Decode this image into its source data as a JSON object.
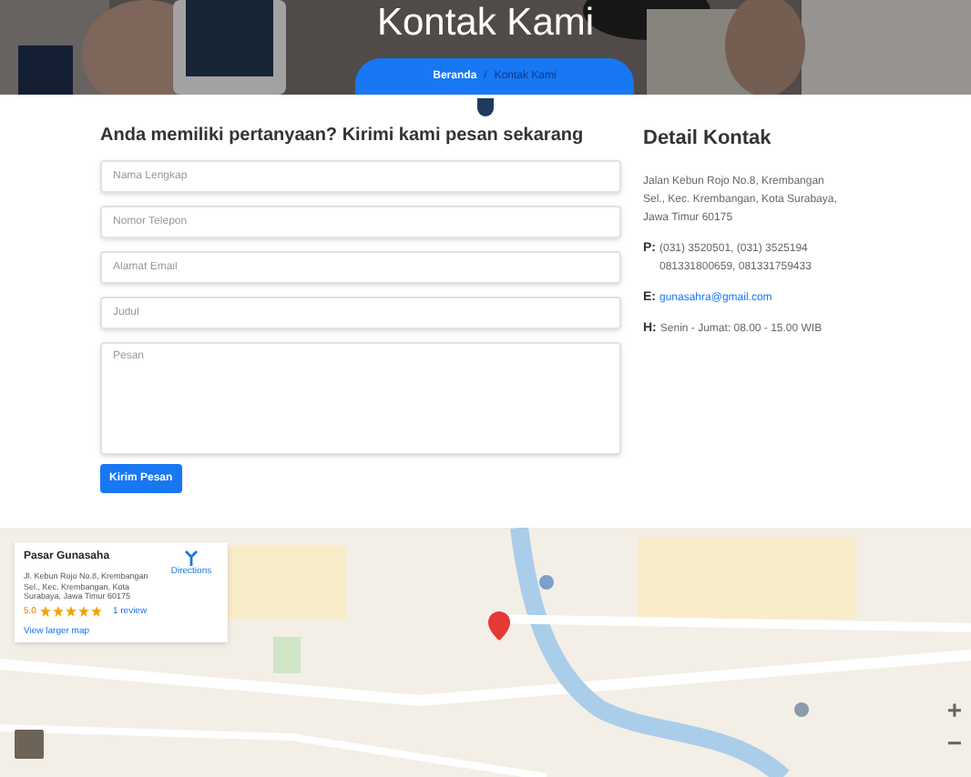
{
  "hero": {
    "kind": "picture",
    "title": "Kontak Kami",
    "breadcrumb_separator": "/",
    "breadcrumb": [
      {
        "label": "Beranda",
        "selected": false
      },
      {
        "label": "Kontak Kami",
        "selected": true
      }
    ]
  },
  "form": {
    "heading": "Anda memiliki pertanyaan? Kirimi kami pesan sekarang",
    "fields": [
      {
        "placeholder": "Nama Lengkap",
        "kind": "input"
      },
      {
        "placeholder": "Nomor Telepon",
        "kind": "input"
      },
      {
        "placeholder": "Alamat Email",
        "kind": "input"
      },
      {
        "placeholder": "Judul",
        "kind": "input"
      },
      {
        "placeholder": "Pesan",
        "kind": "textarea"
      }
    ],
    "submit": "Kirim Pesan"
  },
  "contact": {
    "heading": "Detail Kontak",
    "address": "Jalan Kebun Rojo No.8, Krembangan Sel., Kec. Krembangan, Kota Surabaya, Jawa Timur 60175",
    "items": [
      {
        "label": "P:",
        "kind": "text",
        "lines": [
          "(031) 3520501, (031) 3525194",
          "081331800659, 081331759433"
        ]
      },
      {
        "label": "E:",
        "kind": "link",
        "lines": [
          "gunasahra@gmail.com"
        ]
      },
      {
        "label": "H:",
        "kind": "text",
        "lines": [
          "Senin - Jumat: 08.00 - 15.00 WIB"
        ]
      }
    ]
  },
  "map": {
    "kind": "picture",
    "card": {
      "title": "Pasar Gunasaha",
      "address": "Jl. Kebun Rojo No.8, Krembangan Sel., Kec. Krembangan, Kota Surabaya, Jawa Timur 60175",
      "rating": "5.0",
      "stars": 5,
      "reviews": "1 review",
      "larger": "View larger map",
      "directions": "Directions"
    },
    "zoom": [
      "+",
      "−"
    ]
  }
}
